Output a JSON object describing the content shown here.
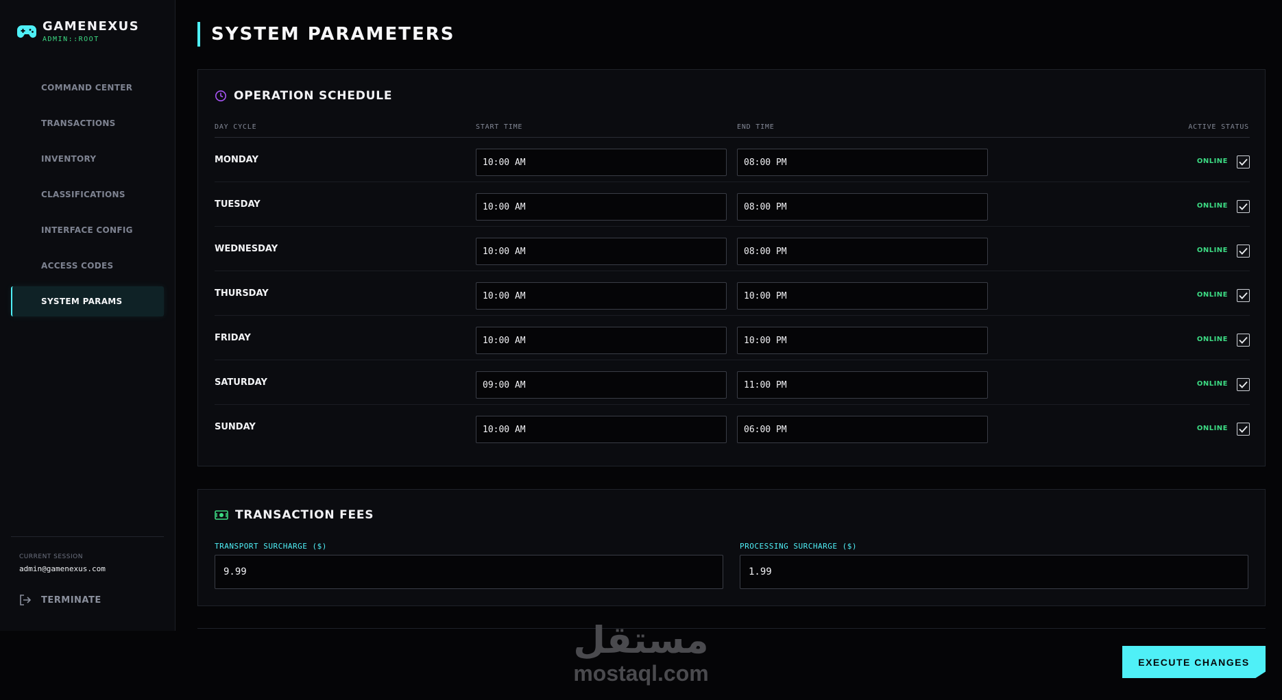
{
  "brand": {
    "title": "GAMENEXUS",
    "subtitle": "ADMIN::ROOT",
    "icon": "gamepad-icon"
  },
  "sidebar": {
    "items": [
      {
        "label": "COMMAND CENTER",
        "active": false
      },
      {
        "label": "TRANSACTIONS",
        "active": false
      },
      {
        "label": "INVENTORY",
        "active": false
      },
      {
        "label": "CLASSIFICATIONS",
        "active": false
      },
      {
        "label": "INTERFACE CONFIG",
        "active": false
      },
      {
        "label": "ACCESS CODES",
        "active": false
      },
      {
        "label": "SYSTEM PARAMS",
        "active": true
      }
    ],
    "session_label": "CURRENT SESSION",
    "session_email": "admin@gamenexus.com",
    "terminate_label": "TERMINATE"
  },
  "page": {
    "title": "SYSTEM PARAMETERS"
  },
  "schedule": {
    "title": "OPERATION SCHEDULE",
    "columns": {
      "day": "DAY CYCLE",
      "start": "START TIME",
      "end": "END TIME",
      "status": "ACTIVE STATUS"
    },
    "rows": [
      {
        "day": "MONDAY",
        "start": "10:00 AM",
        "end": "08:00 PM",
        "status": "ONLINE",
        "checked": true
      },
      {
        "day": "TUESDAY",
        "start": "10:00 AM",
        "end": "08:00 PM",
        "status": "ONLINE",
        "checked": true
      },
      {
        "day": "WEDNESDAY",
        "start": "10:00 AM",
        "end": "08:00 PM",
        "status": "ONLINE",
        "checked": true
      },
      {
        "day": "THURSDAY",
        "start": "10:00 AM",
        "end": "10:00 PM",
        "status": "ONLINE",
        "checked": true
      },
      {
        "day": "FRIDAY",
        "start": "10:00 AM",
        "end": "10:00 PM",
        "status": "ONLINE",
        "checked": true
      },
      {
        "day": "SATURDAY",
        "start": "09:00 AM",
        "end": "11:00 PM",
        "status": "ONLINE",
        "checked": true
      },
      {
        "day": "SUNDAY",
        "start": "10:00 AM",
        "end": "06:00 PM",
        "status": "ONLINE",
        "checked": true
      }
    ]
  },
  "fees": {
    "title": "TRANSACTION FEES",
    "transport_label": "TRANSPORT SURCHARGE ($)",
    "transport_value": "9.99",
    "processing_label": "PROCESSING SURCHARGE ($)",
    "processing_value": "1.99"
  },
  "actions": {
    "execute_label": "EXECUTE CHANGES"
  },
  "watermark": {
    "arabic": "مستقل",
    "latin": "mostaql.com"
  },
  "colors": {
    "accent": "#4ff0f7",
    "online": "#3ddc84",
    "schedule_icon": "#a855f7",
    "fees_icon": "#3ddc84"
  }
}
